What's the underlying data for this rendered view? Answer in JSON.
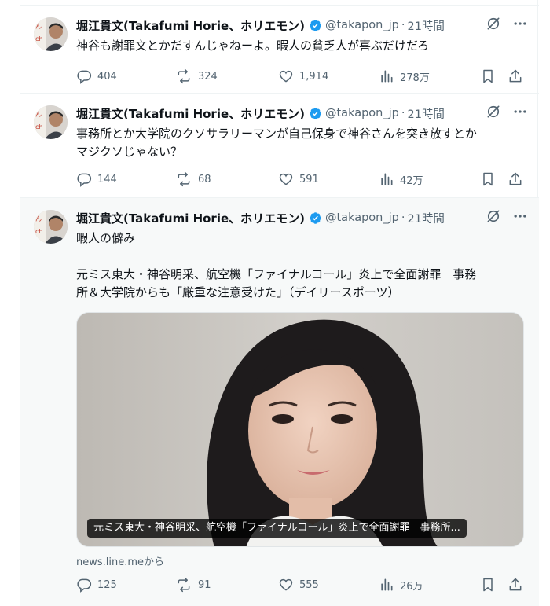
{
  "author": {
    "name": "堀江貴文(Takafumi Horie、ホリエモン)",
    "handle": "@takapon_jp",
    "separator": "·"
  },
  "icons": {
    "verified": "verified-badge-icon",
    "grok": "grok-icon",
    "more": "more-icon",
    "reply": "reply-icon",
    "retweet": "retweet-icon",
    "like": "like-icon",
    "views": "views-icon",
    "bookmark": "bookmark-icon",
    "share": "share-icon"
  },
  "colors": {
    "verified": "#1d9bf0",
    "secondary_text": "#536471",
    "highlight_bg": "#f7f9f9"
  },
  "tweets": [
    {
      "time": "21時間",
      "text": "神谷も謝罪文とかだすんじゃねーよ。暇人の貧乏人が喜ぶだけだろ",
      "replies": "404",
      "retweets": "324",
      "likes": "1,914",
      "views": "278万"
    },
    {
      "time": "21時間",
      "text": "事務所とか大学院のクソサラリーマンが自己保身で神谷さんを突き放すとか\nマジクソじゃない？",
      "replies": "144",
      "retweets": "68",
      "likes": "591",
      "views": "42万"
    },
    {
      "time": "21時間",
      "text": "暇人の僻み\n\n元ミス東大・神谷明采、航空機「ファイナルコール」炎上で全面謝罪　事務\n所＆大学院からも「厳重な注意受けた」（デイリースポーツ）",
      "card_caption": "元ミス東大・神谷明采、航空機「ファイナルコール」炎上で全面謝罪　事務所...",
      "source": "news.line.meから",
      "replies": "125",
      "retweets": "91",
      "likes": "555",
      "views": "26万"
    }
  ]
}
